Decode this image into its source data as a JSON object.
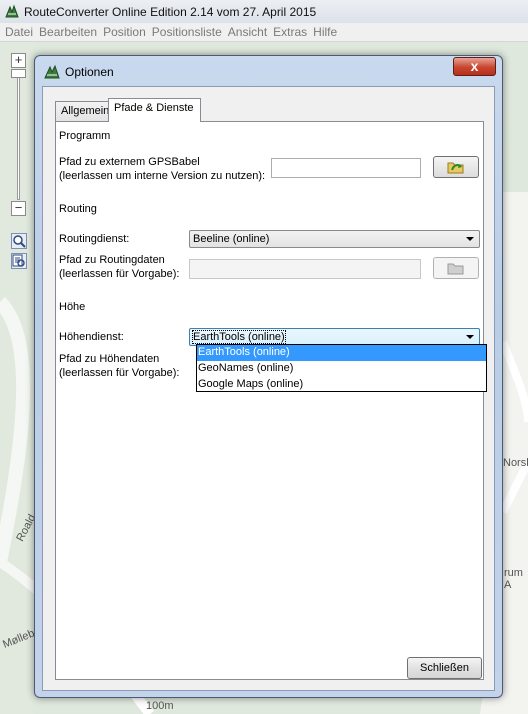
{
  "app": {
    "title": "RouteConverter Online Edition 2.14 vom 27. April 2015",
    "menu": [
      "Datei",
      "Bearbeiten",
      "Position",
      "Positionsliste",
      "Ansicht",
      "Extras",
      "Hilfe"
    ]
  },
  "map": {
    "labels": [
      "Norsk",
      "Roald",
      "Møllebe",
      "rum A",
      "100m"
    ],
    "zoom_in": "+",
    "zoom_out": "−"
  },
  "dialog": {
    "title": "Optionen",
    "close_symbol": "x",
    "tabs": [
      "Allgemein",
      "Pfade & Dienste"
    ],
    "active_tab": "Pfade & Dienste",
    "programm": {
      "section_title": "Programm",
      "gpsbabel_label_line1": "Pfad zu externem GPSBabel",
      "gpsbabel_label_line2": "(leerlassen um interne Version zu nutzen):",
      "gpsbabel_value": ""
    },
    "routing": {
      "section_title": "Routing",
      "service_label": "Routingdienst:",
      "service_value": "Beeline (online)",
      "path_label_line1": "Pfad zu Routingdaten",
      "path_label_line2": "(leerlassen für Vorgabe):",
      "path_value": ""
    },
    "hoehe": {
      "section_title": "Höhe",
      "service_label": "Höhendienst:",
      "service_value": "EarthTools (online)",
      "path_label_line1": "Pfad zu Höhendaten",
      "path_label_line2": "(leerlassen für Vorgabe):",
      "options": [
        "EarthTools (online)",
        "GeoNames (online)",
        "Google Maps (online)"
      ],
      "selected_option": "EarthTools (online)"
    },
    "close_button": "Schließen"
  },
  "colors": {
    "selection": "#3399ff",
    "dialog_frame": "#b9cde6",
    "close_button": "#c8452f",
    "map_background": "#dfe8dc"
  },
  "icons": [
    "app-logo-icon",
    "dialog-logo-icon",
    "folder-browse-icon",
    "zoom-icon",
    "search-list-icon"
  ]
}
